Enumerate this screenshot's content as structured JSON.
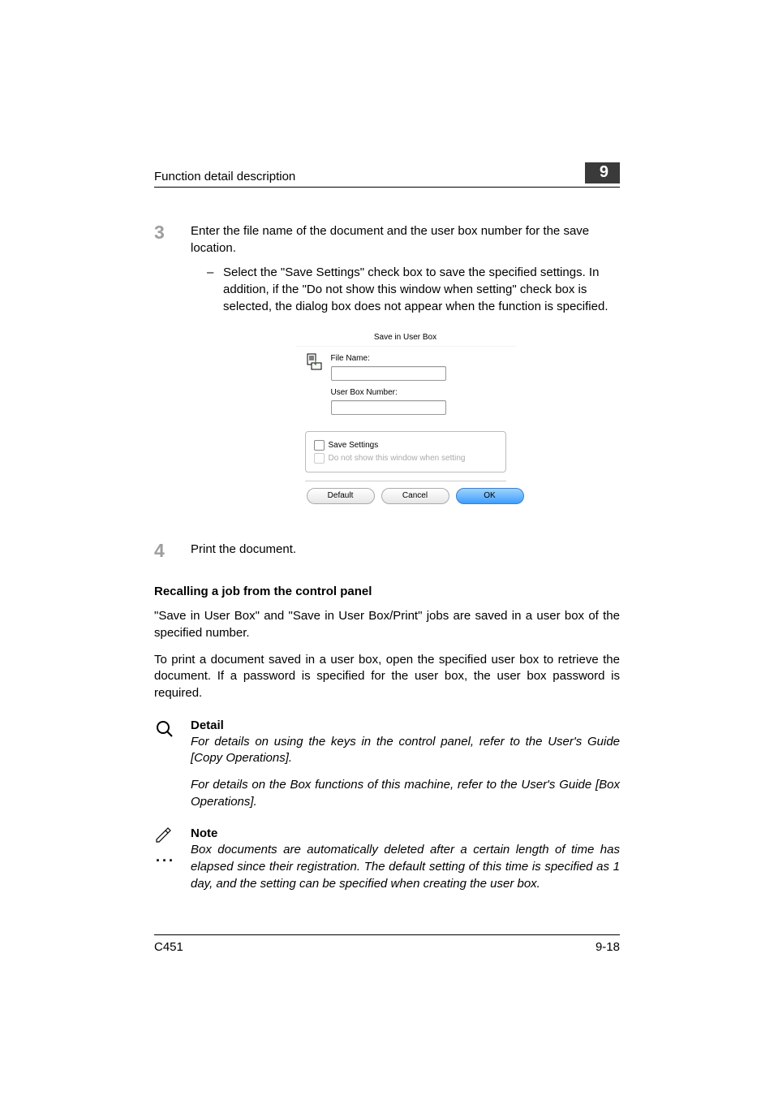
{
  "header": {
    "title": "Function detail description",
    "chapter": "9"
  },
  "steps": {
    "s3": {
      "num": "3",
      "text": "Enter the file name of the document and the user box number for the save location.",
      "sub": "Select the \"Save Settings\" check box to save the specified settings. In addition, if the \"Do not show this window when setting\" check box is selected, the dialog box does not appear when the function is specified."
    },
    "s4": {
      "num": "4",
      "text": "Print the document."
    }
  },
  "dialog": {
    "title": "Save in User Box",
    "file_name_label": "File Name:",
    "user_box_label": "User Box Number:",
    "save_settings": "Save Settings",
    "do_not_show": "Do not show this window when setting",
    "default_btn": "Default",
    "cancel_btn": "Cancel",
    "ok_btn": "OK"
  },
  "section": {
    "heading": "Recalling a job from the control panel",
    "p1": "\"Save in User Box\" and \"Save in User Box/Print\" jobs are saved in a user box of the specified number.",
    "p2": "To print a document saved in a user box, open the specified user box to retrieve the document. If a password is specified for the user box, the user box password is required."
  },
  "detail": {
    "title": "Detail",
    "p1": "For details on using the keys in the control panel, refer to the User's Guide [Copy Operations].",
    "p2": "For details on the Box functions of this machine, refer to the User's Guide [Box Operations]."
  },
  "note": {
    "title": "Note",
    "p1": "Box documents are automatically deleted after a certain length of time has elapsed since their registration. The default setting of this time is specified as 1 day, and the setting can be specified when creating the user box."
  },
  "footer": {
    "model": "C451",
    "page": "9-18"
  }
}
